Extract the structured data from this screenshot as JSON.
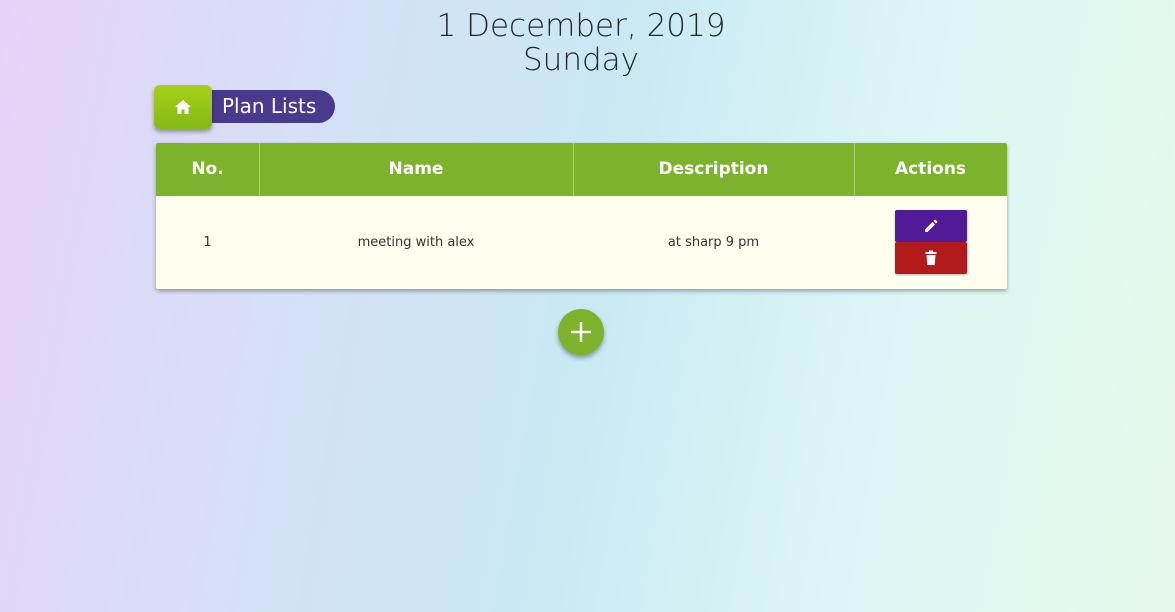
{
  "header": {
    "date": "1 December, 2019",
    "day": "Sunday"
  },
  "breadcrumb": {
    "home_icon": "home-icon",
    "label": "Plan Lists"
  },
  "table": {
    "columns": [
      "No.",
      "Name",
      "Description",
      "Actions"
    ],
    "rows": [
      {
        "no": "1",
        "name": "meeting with alex",
        "description": "at sharp 9 pm"
      }
    ]
  },
  "actions": {
    "edit_icon": "pencil-icon",
    "delete_icon": "trash-icon",
    "add_icon": "plus-icon"
  },
  "colors": {
    "table_header": "#7db22d",
    "edit": "#511b97",
    "delete": "#b11b1b",
    "tag": "#4a3a8e"
  }
}
